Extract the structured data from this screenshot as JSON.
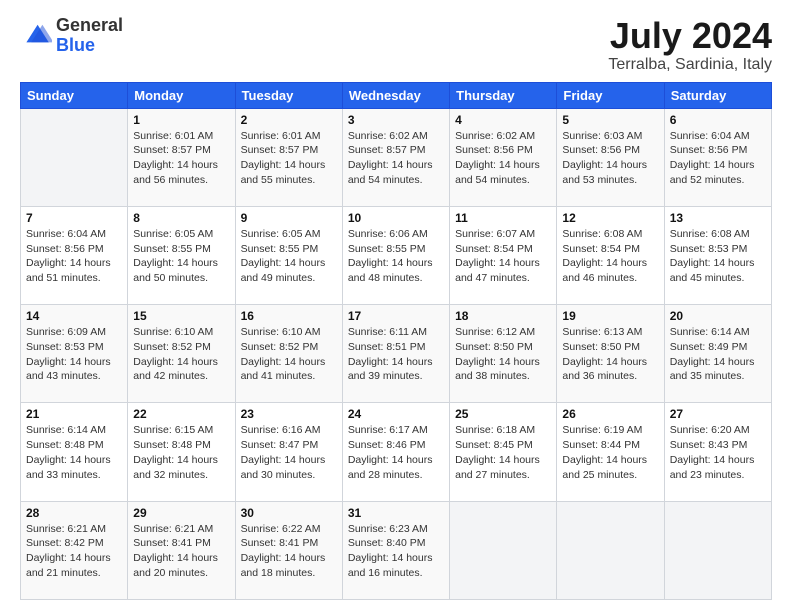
{
  "logo": {
    "general": "General",
    "blue": "Blue"
  },
  "title": "July 2024",
  "location": "Terralba, Sardinia, Italy",
  "days_header": [
    "Sunday",
    "Monday",
    "Tuesday",
    "Wednesday",
    "Thursday",
    "Friday",
    "Saturday"
  ],
  "weeks": [
    [
      {
        "day": "",
        "info": ""
      },
      {
        "day": "1",
        "info": "Sunrise: 6:01 AM\nSunset: 8:57 PM\nDaylight: 14 hours\nand 56 minutes."
      },
      {
        "day": "2",
        "info": "Sunrise: 6:01 AM\nSunset: 8:57 PM\nDaylight: 14 hours\nand 55 minutes."
      },
      {
        "day": "3",
        "info": "Sunrise: 6:02 AM\nSunset: 8:57 PM\nDaylight: 14 hours\nand 54 minutes."
      },
      {
        "day": "4",
        "info": "Sunrise: 6:02 AM\nSunset: 8:56 PM\nDaylight: 14 hours\nand 54 minutes."
      },
      {
        "day": "5",
        "info": "Sunrise: 6:03 AM\nSunset: 8:56 PM\nDaylight: 14 hours\nand 53 minutes."
      },
      {
        "day": "6",
        "info": "Sunrise: 6:04 AM\nSunset: 8:56 PM\nDaylight: 14 hours\nand 52 minutes."
      }
    ],
    [
      {
        "day": "7",
        "info": "Sunrise: 6:04 AM\nSunset: 8:56 PM\nDaylight: 14 hours\nand 51 minutes."
      },
      {
        "day": "8",
        "info": "Sunrise: 6:05 AM\nSunset: 8:55 PM\nDaylight: 14 hours\nand 50 minutes."
      },
      {
        "day": "9",
        "info": "Sunrise: 6:05 AM\nSunset: 8:55 PM\nDaylight: 14 hours\nand 49 minutes."
      },
      {
        "day": "10",
        "info": "Sunrise: 6:06 AM\nSunset: 8:55 PM\nDaylight: 14 hours\nand 48 minutes."
      },
      {
        "day": "11",
        "info": "Sunrise: 6:07 AM\nSunset: 8:54 PM\nDaylight: 14 hours\nand 47 minutes."
      },
      {
        "day": "12",
        "info": "Sunrise: 6:08 AM\nSunset: 8:54 PM\nDaylight: 14 hours\nand 46 minutes."
      },
      {
        "day": "13",
        "info": "Sunrise: 6:08 AM\nSunset: 8:53 PM\nDaylight: 14 hours\nand 45 minutes."
      }
    ],
    [
      {
        "day": "14",
        "info": "Sunrise: 6:09 AM\nSunset: 8:53 PM\nDaylight: 14 hours\nand 43 minutes."
      },
      {
        "day": "15",
        "info": "Sunrise: 6:10 AM\nSunset: 8:52 PM\nDaylight: 14 hours\nand 42 minutes."
      },
      {
        "day": "16",
        "info": "Sunrise: 6:10 AM\nSunset: 8:52 PM\nDaylight: 14 hours\nand 41 minutes."
      },
      {
        "day": "17",
        "info": "Sunrise: 6:11 AM\nSunset: 8:51 PM\nDaylight: 14 hours\nand 39 minutes."
      },
      {
        "day": "18",
        "info": "Sunrise: 6:12 AM\nSunset: 8:50 PM\nDaylight: 14 hours\nand 38 minutes."
      },
      {
        "day": "19",
        "info": "Sunrise: 6:13 AM\nSunset: 8:50 PM\nDaylight: 14 hours\nand 36 minutes."
      },
      {
        "day": "20",
        "info": "Sunrise: 6:14 AM\nSunset: 8:49 PM\nDaylight: 14 hours\nand 35 minutes."
      }
    ],
    [
      {
        "day": "21",
        "info": "Sunrise: 6:14 AM\nSunset: 8:48 PM\nDaylight: 14 hours\nand 33 minutes."
      },
      {
        "day": "22",
        "info": "Sunrise: 6:15 AM\nSunset: 8:48 PM\nDaylight: 14 hours\nand 32 minutes."
      },
      {
        "day": "23",
        "info": "Sunrise: 6:16 AM\nSunset: 8:47 PM\nDaylight: 14 hours\nand 30 minutes."
      },
      {
        "day": "24",
        "info": "Sunrise: 6:17 AM\nSunset: 8:46 PM\nDaylight: 14 hours\nand 28 minutes."
      },
      {
        "day": "25",
        "info": "Sunrise: 6:18 AM\nSunset: 8:45 PM\nDaylight: 14 hours\nand 27 minutes."
      },
      {
        "day": "26",
        "info": "Sunrise: 6:19 AM\nSunset: 8:44 PM\nDaylight: 14 hours\nand 25 minutes."
      },
      {
        "day": "27",
        "info": "Sunrise: 6:20 AM\nSunset: 8:43 PM\nDaylight: 14 hours\nand 23 minutes."
      }
    ],
    [
      {
        "day": "28",
        "info": "Sunrise: 6:21 AM\nSunset: 8:42 PM\nDaylight: 14 hours\nand 21 minutes."
      },
      {
        "day": "29",
        "info": "Sunrise: 6:21 AM\nSunset: 8:41 PM\nDaylight: 14 hours\nand 20 minutes."
      },
      {
        "day": "30",
        "info": "Sunrise: 6:22 AM\nSunset: 8:41 PM\nDaylight: 14 hours\nand 18 minutes."
      },
      {
        "day": "31",
        "info": "Sunrise: 6:23 AM\nSunset: 8:40 PM\nDaylight: 14 hours\nand 16 minutes."
      },
      {
        "day": "",
        "info": ""
      },
      {
        "day": "",
        "info": ""
      },
      {
        "day": "",
        "info": ""
      }
    ]
  ]
}
